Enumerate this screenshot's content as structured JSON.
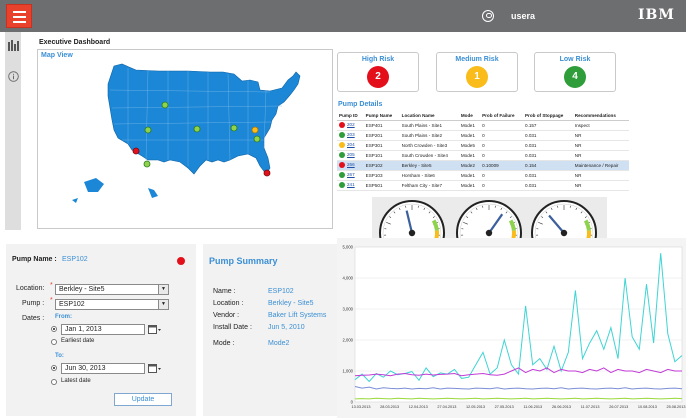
{
  "header": {
    "username": "usera",
    "brand": "IBM",
    "menu_icon": "hamburger-menu-icon",
    "user_icon": "user-circle-icon"
  },
  "rail": {
    "icons": [
      "bar-chart-icon",
      "info-icon"
    ]
  },
  "page_title": "Executive Dashboard",
  "map": {
    "title": "Map View",
    "markers": [
      {
        "state": "Montana",
        "status": "low"
      },
      {
        "state": "Utah",
        "status": "low"
      },
      {
        "state": "Nevada",
        "status": "high"
      },
      {
        "state": "Arizona",
        "status": "low"
      },
      {
        "state": "Kansas",
        "status": "low"
      },
      {
        "state": "Wisconsin",
        "status": "low"
      },
      {
        "state": "Ohio",
        "status": "medium"
      },
      {
        "state": "Kentucky",
        "status": "low"
      },
      {
        "state": "South Carolina",
        "status": "high"
      }
    ]
  },
  "risk": [
    {
      "label": "High Risk",
      "count": "2",
      "color": "#e3101b"
    },
    {
      "label": "Medium Risk",
      "count": "1",
      "color": "#f9bc1a"
    },
    {
      "label": "Low Risk",
      "count": "4",
      "color": "#2e9d3a"
    }
  ],
  "pump_details": {
    "title": "Pump Details",
    "columns": [
      "Pump ID",
      "Pump Name",
      "Location Name",
      "Mode",
      "Prob of Failure",
      "Prob of Stoppage",
      "Recommendations"
    ],
    "rows": [
      {
        "status": "#e3101b",
        "id": "202",
        "name": "ESP401",
        "location": "South Plains - Site1",
        "mode": "Mode1",
        "failure": "0",
        "stoppage": "0.157",
        "rec": "Inspect"
      },
      {
        "status": "#2e9d3a",
        "id": "203",
        "name": "ESP201",
        "location": "South Plains - Site2",
        "mode": "Mode1",
        "failure": "0",
        "stoppage": "0.031",
        "rec": "NR"
      },
      {
        "status": "#f9bc1a",
        "id": "204",
        "name": "ESP301",
        "location": "North Crowden - Site3",
        "mode": "Mode5",
        "failure": "0",
        "stoppage": "0.031",
        "rec": "NR"
      },
      {
        "status": "#2e9d3a",
        "id": "205",
        "name": "ESP101",
        "location": "South Crowden - Site4",
        "mode": "Mode1",
        "failure": "0",
        "stoppage": "0.031",
        "rec": "NR"
      },
      {
        "status": "#e3101b",
        "id": "266",
        "name": "ESP102",
        "location": "Berkley - Site5",
        "mode": "Mode2",
        "failure": "0.10009",
        "stoppage": "0.154",
        "rec": "Maintenance / Repair",
        "selected": true
      },
      {
        "status": "#2e9d3a",
        "id": "267",
        "name": "ESP103",
        "location": "Horsham - Site6",
        "mode": "Mode1",
        "failure": "0",
        "stoppage": "0.031",
        "rec": "NR"
      },
      {
        "status": "#2e9d3a",
        "id": "241",
        "name": "ESP501",
        "location": "Feltham City - Site7",
        "mode": "Mode1",
        "failure": "0",
        "stoppage": "0.031",
        "rec": "NR"
      }
    ]
  },
  "gauges": [
    {
      "value_pct": 45
    },
    {
      "value_pct": 63
    },
    {
      "value_pct": 35
    }
  ],
  "pump_form": {
    "pump_name_label": "Pump Name :",
    "pump_name_value": "ESP102",
    "status_color": "#e3101b",
    "location_label": "Location:",
    "location_value": "Berkley - Site5",
    "pump_label": "Pump :",
    "pump_value": "ESP102",
    "dates_label": "Dates :",
    "from_label": "From:",
    "from_value": "Jan 1, 2013",
    "earliest_label": "Earliest date",
    "to_label": "To:",
    "to_value": "Jun 30, 2013",
    "latest_label": "Latest date",
    "update_label": "Update"
  },
  "summary": {
    "title": "Pump Summary",
    "rows": [
      {
        "label": "Name :",
        "value": "ESP102"
      },
      {
        "label": "Location :",
        "value": "Berkley - Site5"
      },
      {
        "label": "Vendor :",
        "value": "Baker Lift Systems"
      },
      {
        "label": "Install Date :",
        "value": "Jun 5, 2010"
      },
      {
        "label": "Mode :",
        "value": "Mode2"
      }
    ]
  },
  "chart_data": {
    "type": "line",
    "yticks": [
      "5,000",
      "4,000",
      "3,000",
      "2,000",
      "1,000",
      "0"
    ],
    "ylim": [
      0,
      5000
    ],
    "xticks": [
      "13.03.2013",
      "28.03.2013",
      "12.04.2013",
      "27.04.2013",
      "12.05.2013",
      "27.05.2013",
      "11.06.2013",
      "26.06.2013",
      "11.07.2013",
      "26.07.2013",
      "10.08.2013",
      "25.08.2013"
    ],
    "series": [
      {
        "color": "#3fd4d4",
        "values": [
          720,
          900,
          660,
          920,
          800,
          1000,
          880,
          920,
          980,
          700,
          1100,
          820,
          940,
          900,
          1050,
          760,
          800,
          1200,
          1600,
          900,
          1100,
          2000,
          1200,
          900,
          3100,
          1200,
          1400,
          1050,
          1800,
          1000,
          1600,
          3600,
          1400,
          1900,
          2300,
          1700,
          2400,
          1400,
          4000,
          2100,
          1700,
          3800,
          1900,
          4800,
          2200,
          1300,
          1500
        ]
      },
      {
        "color": "#c23bd6",
        "values": [
          850,
          860,
          870,
          900,
          880,
          850,
          900,
          920,
          880,
          860,
          900,
          870,
          890,
          900,
          920,
          850,
          880,
          900,
          920,
          880,
          860,
          900,
          1000,
          1100,
          950,
          1050,
          1000,
          1100,
          950,
          1050,
          1000,
          1000,
          950,
          1050,
          1000,
          1100,
          950,
          1050,
          1000,
          1000,
          950,
          1050,
          1000,
          950,
          1050,
          1000,
          1000
        ]
      },
      {
        "color": "#9ad93a",
        "values": [
          100,
          110,
          100,
          120,
          110,
          100,
          120,
          110,
          100,
          120,
          110,
          100,
          110,
          120,
          110,
          100,
          110,
          120,
          100,
          110,
          120,
          110,
          100,
          110,
          120,
          100,
          110,
          120,
          110,
          100,
          110,
          120,
          100,
          110,
          120,
          110,
          100,
          110,
          120,
          100,
          110,
          120,
          110,
          100,
          110,
          120,
          110
        ]
      },
      {
        "color": "#7b8ed6",
        "values": [
          500,
          450,
          480,
          420,
          460,
          440,
          430,
          450,
          420,
          440,
          430,
          460,
          420,
          450,
          440,
          430,
          420,
          450,
          440,
          430,
          460,
          420,
          440,
          450,
          430,
          420,
          440,
          450,
          430,
          460,
          420,
          440,
          450,
          430,
          420,
          440,
          450,
          430,
          460,
          420,
          440,
          450,
          430,
          420,
          440,
          450,
          430
        ]
      }
    ]
  }
}
